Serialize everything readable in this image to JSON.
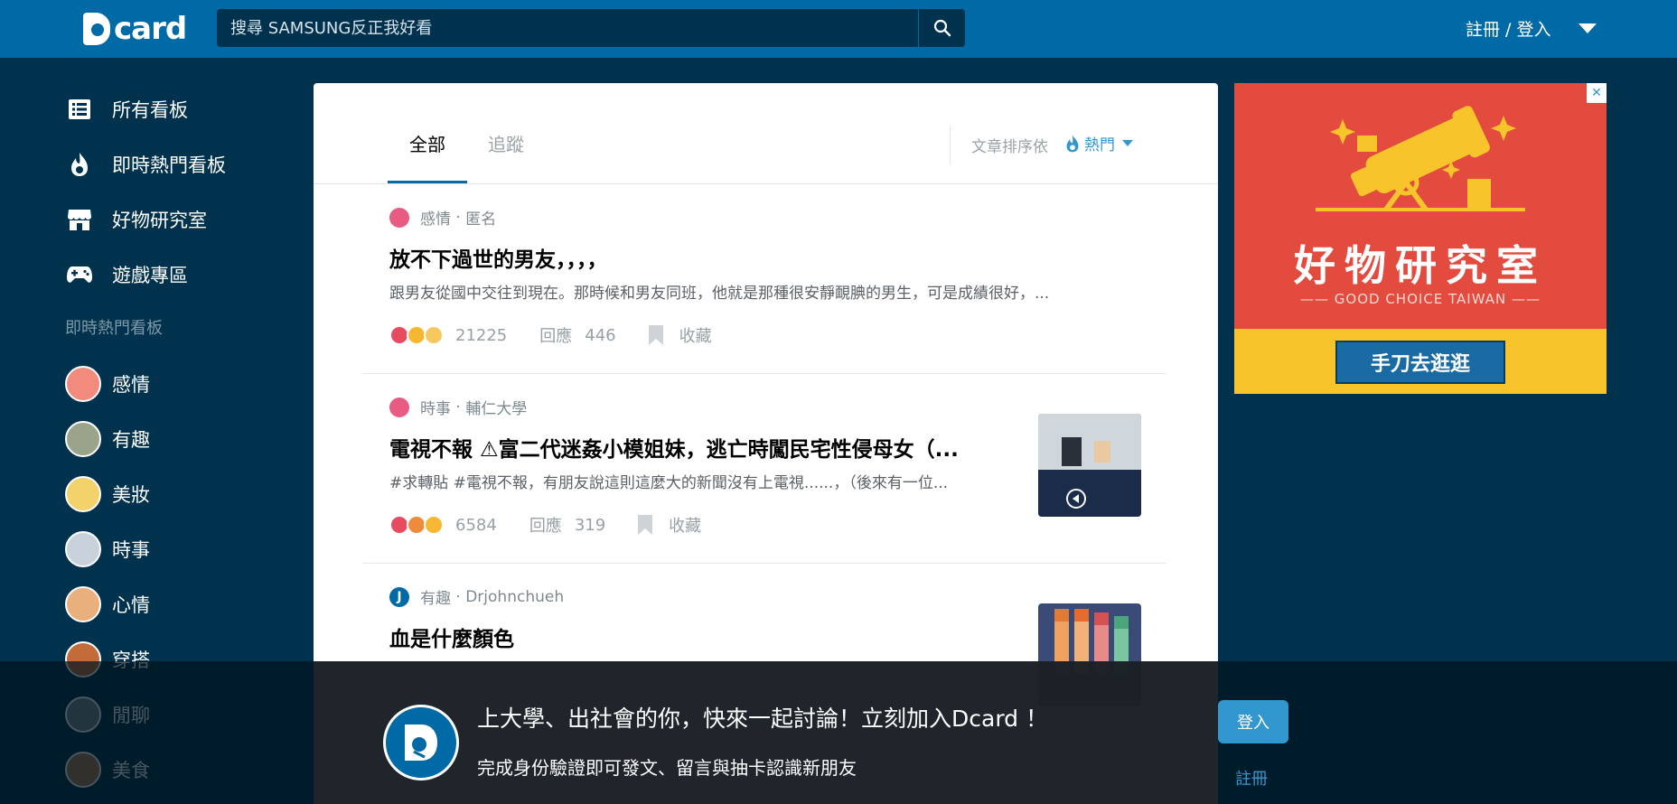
{
  "header": {
    "logo_text": "card",
    "search_placeholder": "搜尋 SAMSUNG反正我好看",
    "auth_label": "註冊 / 登入"
  },
  "sidebar": {
    "nav": [
      {
        "label": "所有看板",
        "icon": "list-icon"
      },
      {
        "label": "即時熱門看板",
        "icon": "flame-icon"
      },
      {
        "label": "好物研究室",
        "icon": "store-icon"
      },
      {
        "label": "遊戲專區",
        "icon": "gamepad-icon"
      }
    ],
    "section_title": "即時熱門看板",
    "boards": [
      {
        "label": "感情",
        "color": "#f28b7e"
      },
      {
        "label": "有趣",
        "color": "#9aa48a"
      },
      {
        "label": "美妝",
        "color": "#f3d26b"
      },
      {
        "label": "時事",
        "color": "#c9d2dc"
      },
      {
        "label": "心情",
        "color": "#e9b07d"
      },
      {
        "label": "穿搭",
        "color": "#c46b3a"
      },
      {
        "label": "閒聊",
        "color": "#7a8891"
      },
      {
        "label": "美食",
        "color": "#b07a4f"
      }
    ]
  },
  "main": {
    "tabs": [
      {
        "label": "全部",
        "active": true
      },
      {
        "label": "追蹤",
        "active": false
      }
    ],
    "sort_label": "文章排序依",
    "sort_value": "熱門",
    "posts": [
      {
        "board": "感情",
        "author": "匿名",
        "avatar_color": "#e85b82",
        "avatar_text": "",
        "title": "放不下過世的男友，，，，",
        "excerpt": "跟男友從國中交往到現在。那時候和男友同班，他就是那種很安靜靦腆的男生，可是成績很好，...",
        "likes": "21225",
        "reply_label": "回應",
        "replies": "446",
        "save_label": "收藏",
        "reactions": [
          "#e84a5f",
          "#f7b733",
          "#f7c85f"
        ]
      },
      {
        "board": "時事",
        "author": "輔仁大學",
        "avatar_color": "#e85b82",
        "avatar_text": "",
        "title": "電視不報 ⚠富二代迷姦小模姐妹，逃亡時闖民宅性侵母女（...",
        "excerpt": "#求轉貼 #電視不報，有朋友說這則這麼大的新聞沒有上電視......，（後來有一位...",
        "likes": "6584",
        "reply_label": "回應",
        "replies": "319",
        "save_label": "收藏",
        "reactions": [
          "#e84a5f",
          "#f08a3c",
          "#f7b733"
        ]
      },
      {
        "board": "有趣",
        "author": "Drjohnchueh",
        "avatar_color": "#006aa6",
        "avatar_text": "J",
        "title": "血是什麼顏色",
        "excerpt": "",
        "likes": "",
        "reply_label": "",
        "replies": "",
        "save_label": "",
        "reactions": []
      }
    ]
  },
  "ad": {
    "title": "好物研究室",
    "subtitle": "GOOD CHOICE TAIWAN",
    "button_label": "手刀去逛逛",
    "close_label": "✕"
  },
  "banner": {
    "title": "上大學、出社會的你，快來一起討論！立刻加入Dcard ！",
    "subtitle": "完成身份驗證即可發文、留言與抽卡認識新朋友",
    "login_label": "登入",
    "register_label": "註冊"
  },
  "colors": {
    "header": "#006aa6",
    "background": "#00324e",
    "accent": "#3397cf"
  }
}
